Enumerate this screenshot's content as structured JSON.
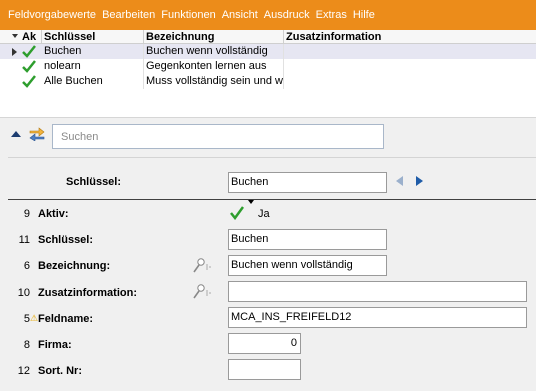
{
  "menu": {
    "items": [
      "Feldvorgabewerte",
      "Bearbeiten",
      "Funktionen",
      "Ansicht",
      "Ausdruck",
      "Extras",
      "Hilfe"
    ]
  },
  "grid": {
    "columns": [
      "Ak",
      "Schlüssel",
      "Bezeichnung",
      "Zusatzinformation"
    ],
    "rows": [
      {
        "active": true,
        "key": "Buchen",
        "description": "Buchen wenn vollständig",
        "extra": ""
      },
      {
        "active": true,
        "key": "nolearn",
        "description": "Gegenkonten lernen aus",
        "extra": ""
      },
      {
        "active": true,
        "key": "Alle Buchen",
        "description": "Muss vollständig sein und wir",
        "extra": ""
      }
    ]
  },
  "search": {
    "placeholder": "Suchen",
    "value": ""
  },
  "form": {
    "key_label": "Schlüssel:",
    "key_value": "Buchen",
    "fields": [
      {
        "num": "9",
        "label": "Aktiv:",
        "value": "Ja"
      },
      {
        "num": "11",
        "label": "Schlüssel:",
        "value": "Buchen"
      },
      {
        "num": "6",
        "label": "Bezeichnung:",
        "value": "Buchen wenn vollständig"
      },
      {
        "num": "10",
        "label": "Zusatzinformation:",
        "value": ""
      },
      {
        "num": "5",
        "label": "Feldname:",
        "value": "MCA_INS_FREIFELD12"
      },
      {
        "num": "8",
        "label": "Firma:",
        "value": "0"
      },
      {
        "num": "12",
        "label": "Sort. Nr:",
        "value": ""
      }
    ]
  },
  "colors": {
    "menubar": "#ec8c1a",
    "selected_row": "#e6e6f2",
    "check_green": "#2e9e2e",
    "nav_blue": "#1f5ca8"
  },
  "icons": [
    "sort-down-icon",
    "row-indicator-icon",
    "check-icon",
    "collapse-up-icon",
    "swap-arrows-icon",
    "nav-prev-icon",
    "nav-next-icon",
    "pin-icon",
    "warning-icon"
  ]
}
